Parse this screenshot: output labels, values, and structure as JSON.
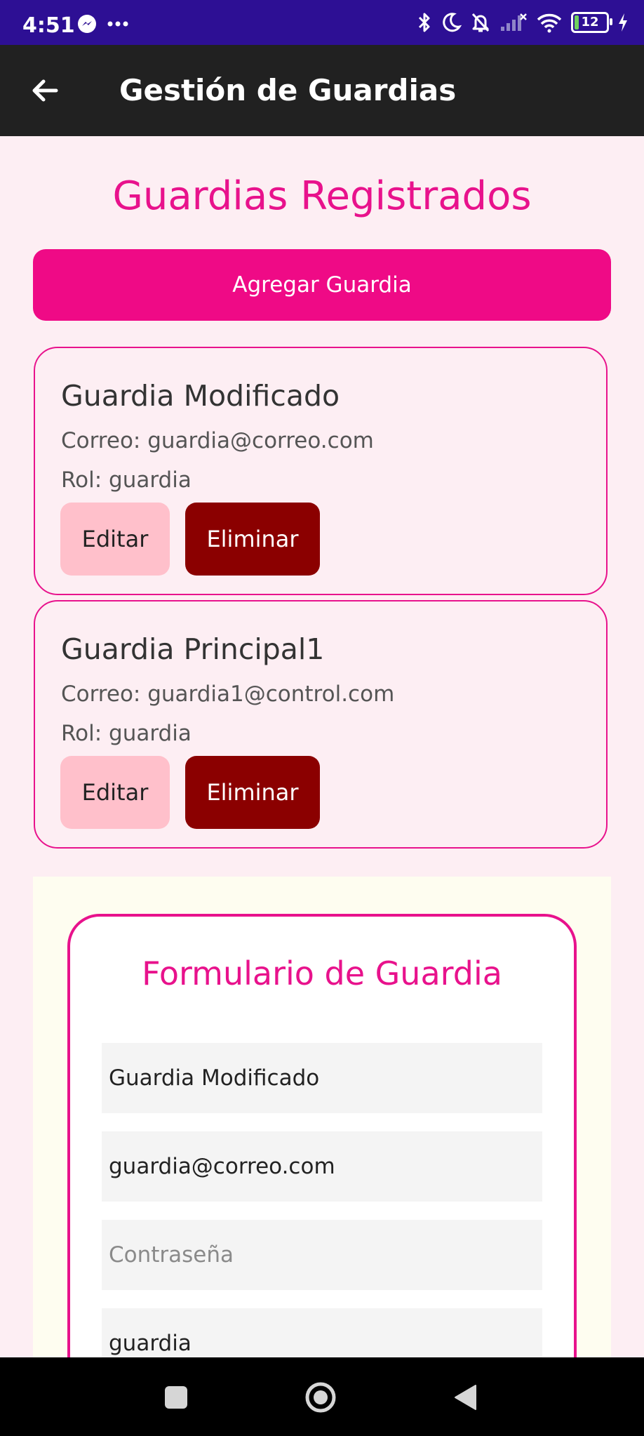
{
  "status_bar": {
    "time": "4:51",
    "battery_level": "12",
    "icons": [
      "messenger-icon",
      "more-dots-icon",
      "bluetooth-icon",
      "moon-icon",
      "bell-off-icon",
      "signal-icon",
      "wifi-icon",
      "battery-icon",
      "charging-icon"
    ]
  },
  "app_bar": {
    "title": "Gestión de Guardias"
  },
  "page": {
    "title": "Guardias Registrados",
    "add_button": "Agregar Guardia"
  },
  "guards": [
    {
      "name": "Guardia Modificado",
      "email": "Correo: guardia@correo.com",
      "role": "Rol: guardia",
      "edit_label": "Editar",
      "delete_label": "Eliminar"
    },
    {
      "name": "Guardia Principal1",
      "email": "Correo: guardia1@control.com",
      "role": "Rol: guardia",
      "edit_label": "Editar",
      "delete_label": "Eliminar"
    }
  ],
  "form": {
    "title": "Formulario de Guardia",
    "name_value": "Guardia Modificado",
    "email_value": "guardia@correo.com",
    "password_value": "",
    "password_placeholder": "Contraseña",
    "role_value": "guardia"
  },
  "colors": {
    "accent": "#e8128c",
    "button_primary": "#ef0a86",
    "edit_button": "#ffc0cb",
    "delete_button": "#8b0000",
    "background": "#fdeef3",
    "status_bar": "#2d0f94",
    "app_bar": "#212121"
  }
}
